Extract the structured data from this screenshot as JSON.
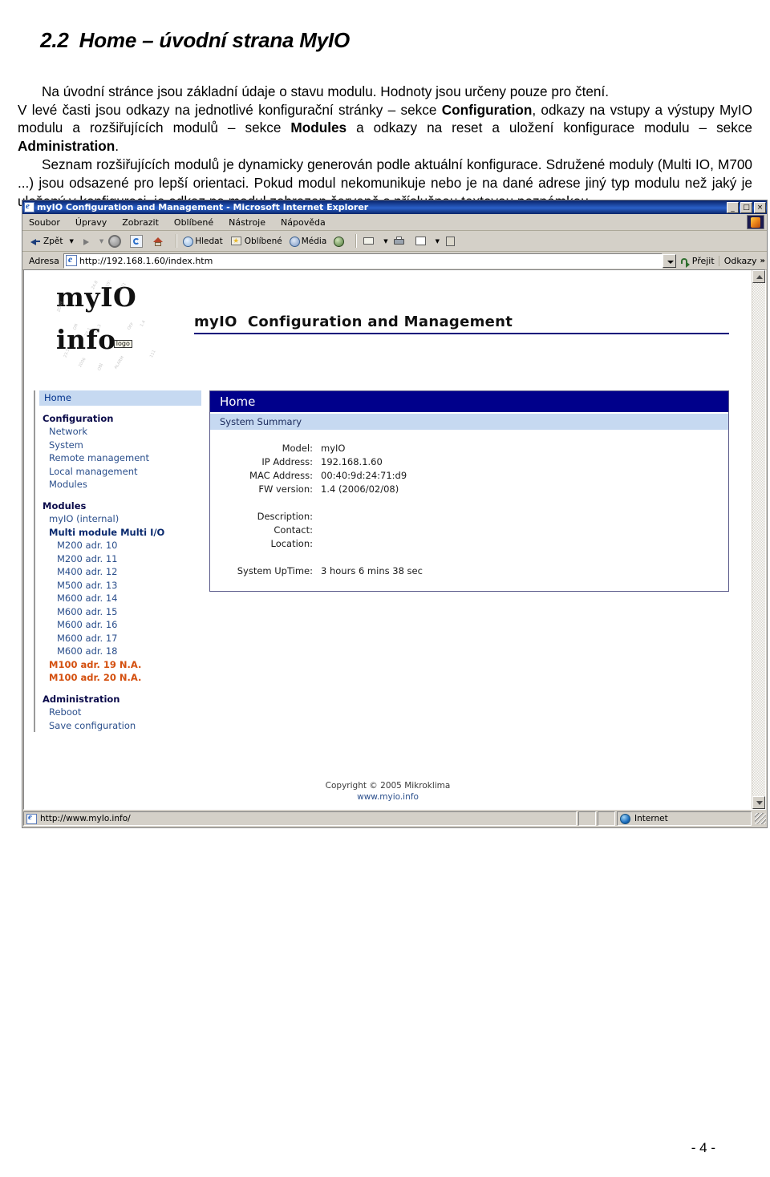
{
  "document": {
    "heading_number": "2.2",
    "heading_text": "Home – úvodní strana MyIO",
    "paragraph1_line1": "Na úvodní stránce jsou základní údaje o stavu modulu. Hodnoty jsou určeny pouze pro čtení.",
    "paragraph1_line2_a": "V levé časti jsou odkazy na jednotlivé konfigurační stránky – sekce ",
    "paragraph1_b1": "Configuration",
    "paragraph1_line2_b": ", odkazy na vstupy a výstupy MyIO modulu a rozšiřujících modulů – sekce ",
    "paragraph1_b2": "Modules",
    "paragraph1_line2_c": " a odkazy na reset a uložení konfigurace modulu – sekce ",
    "paragraph1_b3": "Administration",
    "paragraph1_line2_d": ".",
    "paragraph2": "Seznam rozšiřujících modulů je dynamicky generován podle aktuální konfigurace. Sdružené moduly (Multi IO, M700 ...) jsou odsazené pro lepší orientaci. Pokud modul nekomunikuje nebo je na dané adrese jiný typ modulu než jaký je uložený v konfiguraci, je odkaz na modul zobrazen červeně s příslušnou textovou poznámkou.",
    "page_number": "- 4 -"
  },
  "browser": {
    "window_title": "myIO  Configuration and Management - Microsoft Internet Explorer",
    "window_buttons": {
      "minimize": "_",
      "maximize": "□",
      "close": "×"
    },
    "menu": [
      {
        "label": "Soubor",
        "accel": "S"
      },
      {
        "label": "Úpravy",
        "accel": "a"
      },
      {
        "label": "Zobrazit",
        "accel": "Z"
      },
      {
        "label": "Oblíbené",
        "accel": "O"
      },
      {
        "label": "Nástroje",
        "accel": "N"
      },
      {
        "label": "Nápověda",
        "accel": "v"
      }
    ],
    "toolbar": [
      {
        "label": "Zpět",
        "icon": "back-icon",
        "dropdown": true,
        "enabled": true
      },
      {
        "label": "",
        "icon": "forward-icon",
        "dropdown": true,
        "enabled": false
      },
      {
        "label": "",
        "icon": "stop-icon",
        "enabled": false
      },
      {
        "label": "",
        "icon": "refresh-icon",
        "enabled": true
      },
      {
        "label": "",
        "icon": "home-icon",
        "enabled": true
      },
      {
        "label": "Hledat",
        "icon": "search-icon",
        "enabled": true
      },
      {
        "label": "Oblíbené",
        "icon": "favorites-icon",
        "enabled": true
      },
      {
        "label": "Média",
        "icon": "media-icon",
        "enabled": true
      },
      {
        "label": "",
        "icon": "history-icon",
        "enabled": true
      },
      {
        "label": "",
        "icon": "mail-icon",
        "dropdown": true,
        "enabled": true
      },
      {
        "label": "",
        "icon": "print-icon",
        "enabled": true
      },
      {
        "label": "",
        "icon": "edit-icon",
        "dropdown": true,
        "enabled": true
      },
      {
        "label": "",
        "icon": "discuss-icon",
        "enabled": true
      }
    ],
    "address": {
      "label": "Adresa",
      "value": "http://192.168.1.60/index.htm",
      "go_label": "Přejit",
      "links_label": "Odkazy",
      "links_chevron": "»"
    },
    "statusbar": {
      "url": "http://www.myIo.info/",
      "zone": "Internet"
    }
  },
  "webpage": {
    "logo": {
      "line1": "myIO",
      "line2": "info",
      "badge": "logo"
    },
    "page_title": "myIO  Configuration and Management",
    "sidebar": {
      "home": "Home",
      "groups": [
        {
          "title": "Configuration",
          "items": [
            {
              "label": "Network",
              "style": "link"
            },
            {
              "label": "System",
              "style": "link"
            },
            {
              "label": "Remote management",
              "style": "link"
            },
            {
              "label": "Local management",
              "style": "link"
            },
            {
              "label": "Modules",
              "style": "link"
            }
          ]
        },
        {
          "title": "Modules",
          "items": [
            {
              "label": "myIO (internal)",
              "style": "link"
            },
            {
              "label": "Multi module Multi I/O",
              "style": "bold"
            },
            {
              "label": "M200 adr. 10",
              "style": "sub"
            },
            {
              "label": "M200 adr. 11",
              "style": "sub"
            },
            {
              "label": "M400 adr. 12",
              "style": "sub"
            },
            {
              "label": "M500 adr. 13",
              "style": "sub"
            },
            {
              "label": "M600 adr. 14",
              "style": "sub"
            },
            {
              "label": "M600 adr. 15",
              "style": "sub"
            },
            {
              "label": "M600 adr. 16",
              "style": "sub"
            },
            {
              "label": "M600 adr. 17",
              "style": "sub"
            },
            {
              "label": "M600 adr. 18",
              "style": "sub"
            },
            {
              "label": "M100 adr. 19 N.A.",
              "style": "na"
            },
            {
              "label": "M100 adr. 20 N.A.",
              "style": "na"
            }
          ]
        },
        {
          "title": "Administration",
          "items": [
            {
              "label": "Reboot",
              "style": "link"
            },
            {
              "label": "Save configuration",
              "style": "link"
            }
          ]
        }
      ]
    },
    "content": {
      "header": "Home",
      "section": "System Summary",
      "rows": [
        {
          "label": "Model:",
          "value": "myIO"
        },
        {
          "label": "IP Address:",
          "value": "192.168.1.60"
        },
        {
          "label": "MAC Address:",
          "value": "00:40:9d:24:71:d9"
        },
        {
          "label": "FW version:",
          "value": "1.4 (2006/02/08)"
        },
        {
          "label": "",
          "value": ""
        },
        {
          "label": "Description:",
          "value": ""
        },
        {
          "label": "Contact:",
          "value": ""
        },
        {
          "label": "Location:",
          "value": ""
        },
        {
          "label": "",
          "value": ""
        },
        {
          "label": "System UpTime:",
          "value": "3 hours 6 mins 38 sec"
        }
      ]
    },
    "footer": {
      "copyright": "Copyright © 2005 Mikroklima",
      "site": "www.myio.info"
    }
  },
  "colors": {
    "title_bar": "#0a246a",
    "panel_header": "#00008b",
    "panel_subheader": "#c6d9f1",
    "link": "#2b4f8c",
    "na_red": "#d4500f",
    "chrome": "#d4d0c8"
  }
}
